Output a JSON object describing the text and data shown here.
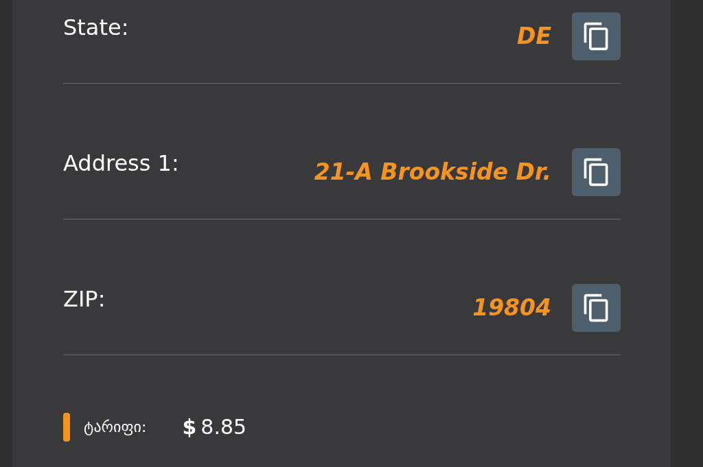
{
  "fields": [
    {
      "label": "State:",
      "value": "DE"
    },
    {
      "label": "Address 1:",
      "value": "21-A Brookside Dr."
    },
    {
      "label": "ZIP:",
      "value": "19804"
    }
  ],
  "fee": {
    "label": "ტარიფი:",
    "currency": "$",
    "amount": "8.85"
  }
}
